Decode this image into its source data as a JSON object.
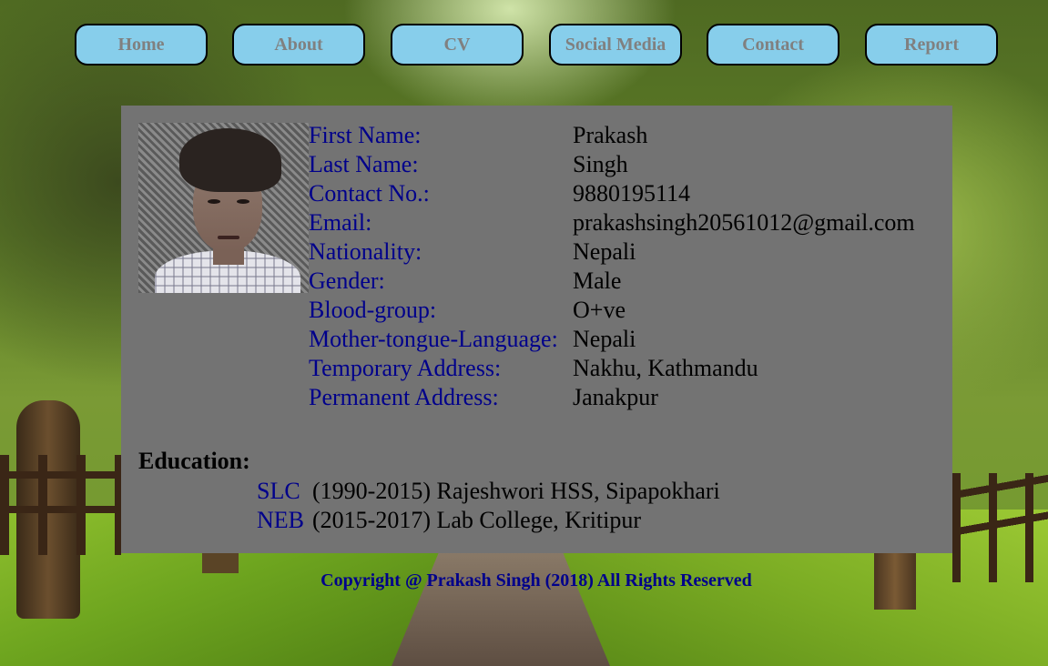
{
  "nav": {
    "items": [
      {
        "label": "Home"
      },
      {
        "label": "About"
      },
      {
        "label": "CV"
      },
      {
        "label": "Social Media"
      },
      {
        "label": "Contact"
      },
      {
        "label": "Report"
      }
    ]
  },
  "profile": {
    "fields": [
      {
        "label": "First Name:",
        "value": "Prakash"
      },
      {
        "label": "Last Name:",
        "value": "Singh"
      },
      {
        "label": "Contact No.:",
        "value": "9880195114"
      },
      {
        "label": "Email:",
        "value": "prakashsingh20561012@gmail.com"
      },
      {
        "label": "Nationality:",
        "value": "Nepali"
      },
      {
        "label": "Gender:",
        "value": "Male"
      },
      {
        "label": "Blood-group:",
        "value": "O+ve"
      },
      {
        "label": "Mother-tongue-Language:",
        "value": "Nepali"
      },
      {
        "label": "Temporary Address:",
        "value": "Nakhu, Kathmandu"
      },
      {
        "label": "Permanent Address:",
        "value": "Janakpur"
      }
    ]
  },
  "education": {
    "title": "Education:",
    "items": [
      {
        "level": "SLC",
        "detail": "(1990-2015) Rajeshwori HSS, Sipapokhari"
      },
      {
        "level": "NEB",
        "detail": "(2015-2017) Lab College, Kritipur"
      }
    ]
  },
  "footer": {
    "text": "Copyright @ Prakash Singh (2018) All Rights Reserved"
  },
  "colors": {
    "nav_button_bg": "#87ceeb",
    "nav_button_text": "#808080",
    "panel_bg": "#737373",
    "label_color": "#00008b",
    "value_color": "#000000",
    "footer_color": "#00008b"
  }
}
